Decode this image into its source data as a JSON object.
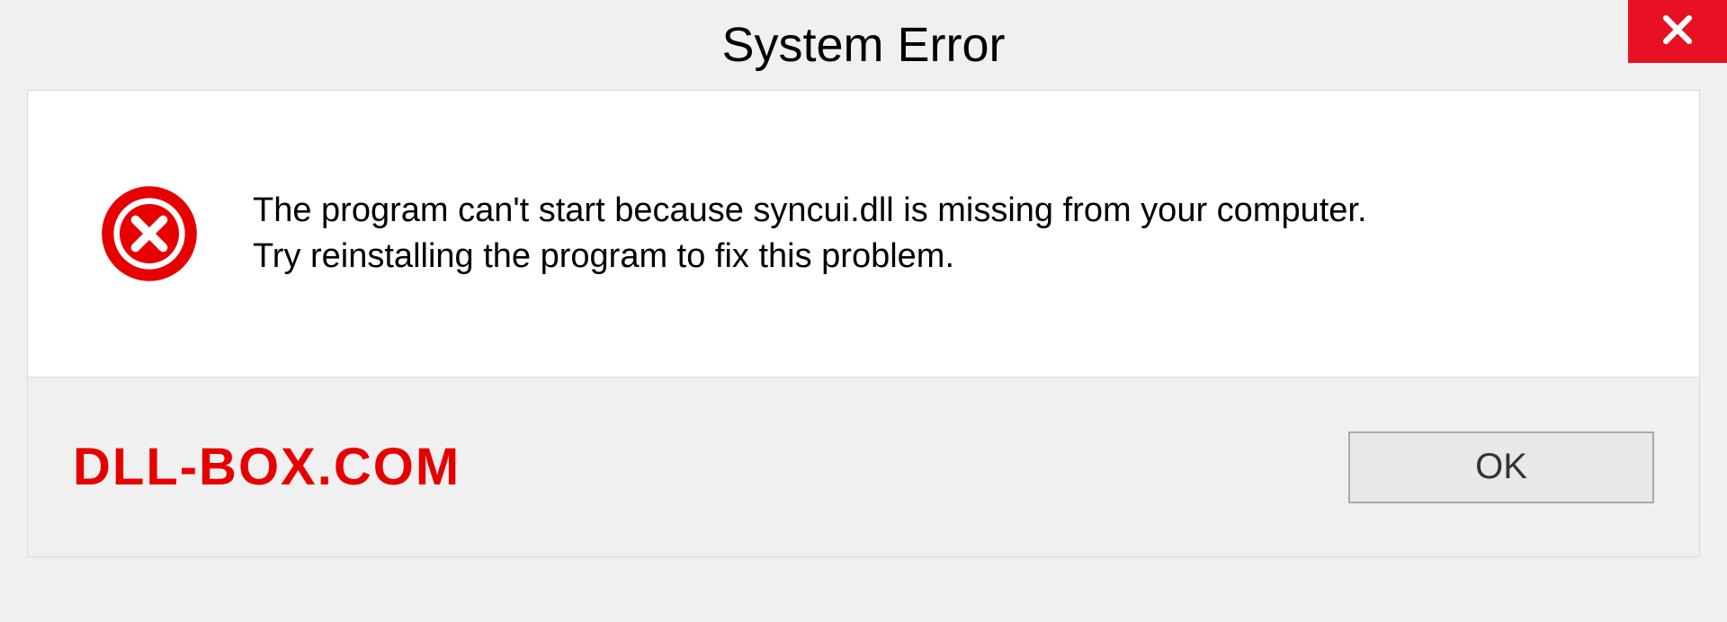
{
  "dialog": {
    "title": "System Error",
    "message_line1": "The program can't start because syncui.dll is missing from your computer.",
    "message_line2": "Try reinstalling the program to fix this problem.",
    "ok_label": "OK"
  },
  "watermark": "DLL-BOX.COM",
  "colors": {
    "close_bg": "#e81123",
    "error_icon": "#e60000",
    "watermark": "#e60000"
  }
}
